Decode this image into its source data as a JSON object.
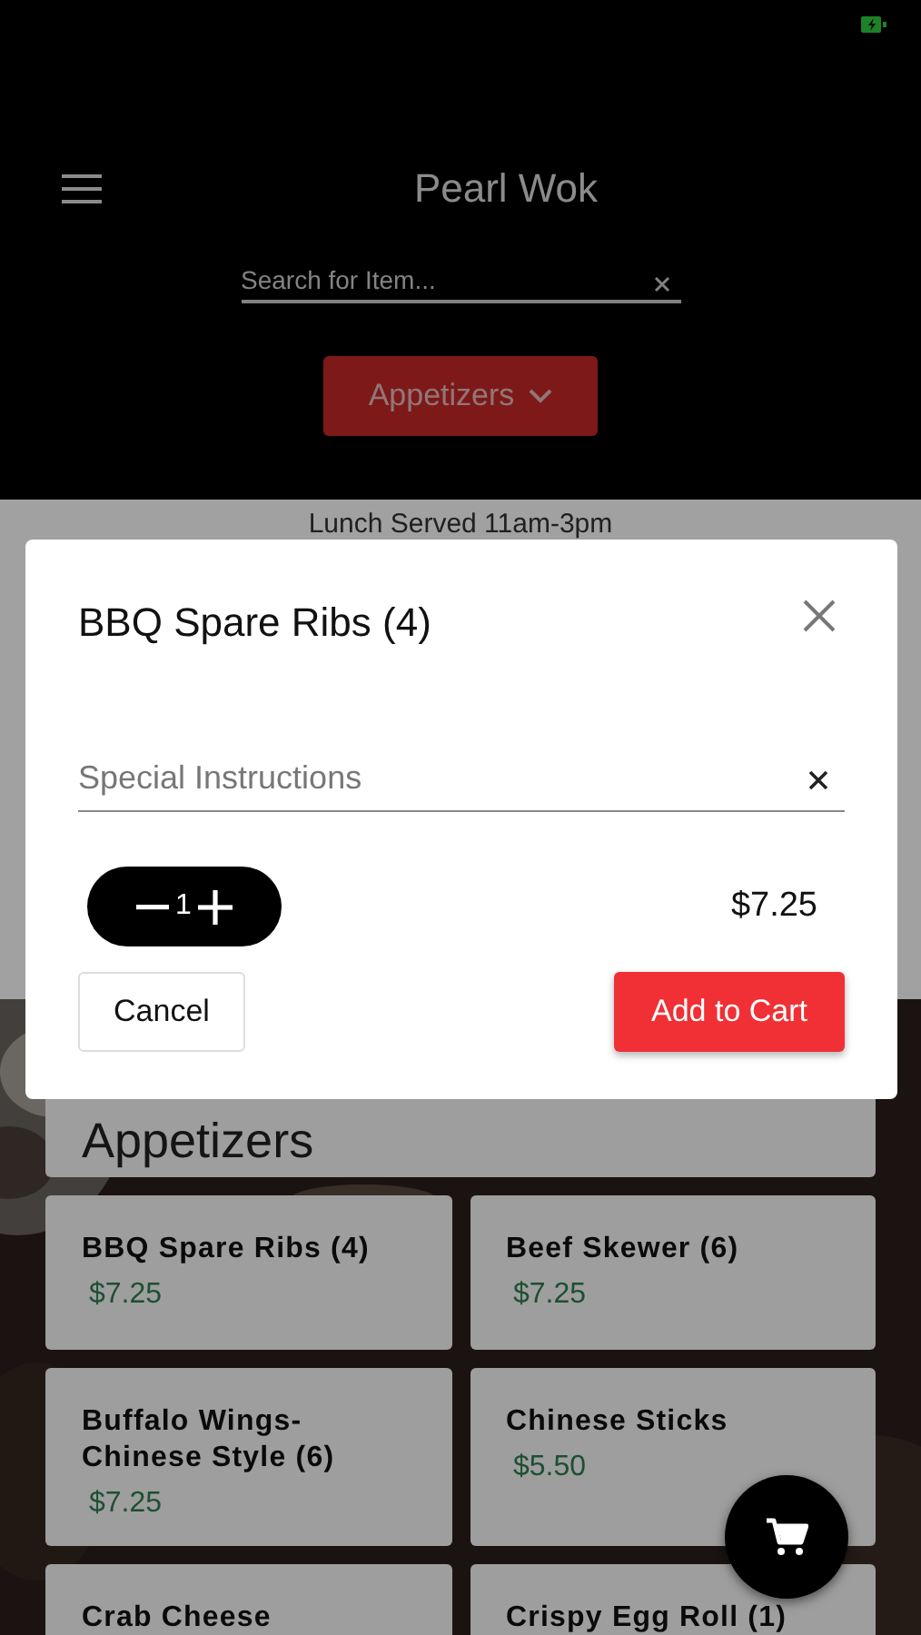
{
  "header": {
    "title": "Pearl Wok",
    "search": {
      "placeholder": "Search for Item..."
    },
    "category_button": "Appetizers"
  },
  "notice": "Lunch Served 11am-3pm",
  "section_title": "Appetizers",
  "items": [
    {
      "name": "BBQ Spare Ribs (4)",
      "price": "$7.25"
    },
    {
      "name": "Beef Skewer (6)",
      "price": "$7.25"
    },
    {
      "name": "Buffalo Wings-Chinese Style (6)",
      "price": "$7.25"
    },
    {
      "name": "Chinese Sticks",
      "price": "$5.50"
    },
    {
      "name": "Crab Cheese"
    },
    {
      "name": "Crispy Egg Roll (1)"
    }
  ],
  "dialog": {
    "title": "BBQ Spare Ribs (4)",
    "instructions": {
      "placeholder": "Special Instructions"
    },
    "quantity": "1",
    "price": "$7.25",
    "cancel_button": "Cancel",
    "confirm_button": "Add to Cart"
  }
}
